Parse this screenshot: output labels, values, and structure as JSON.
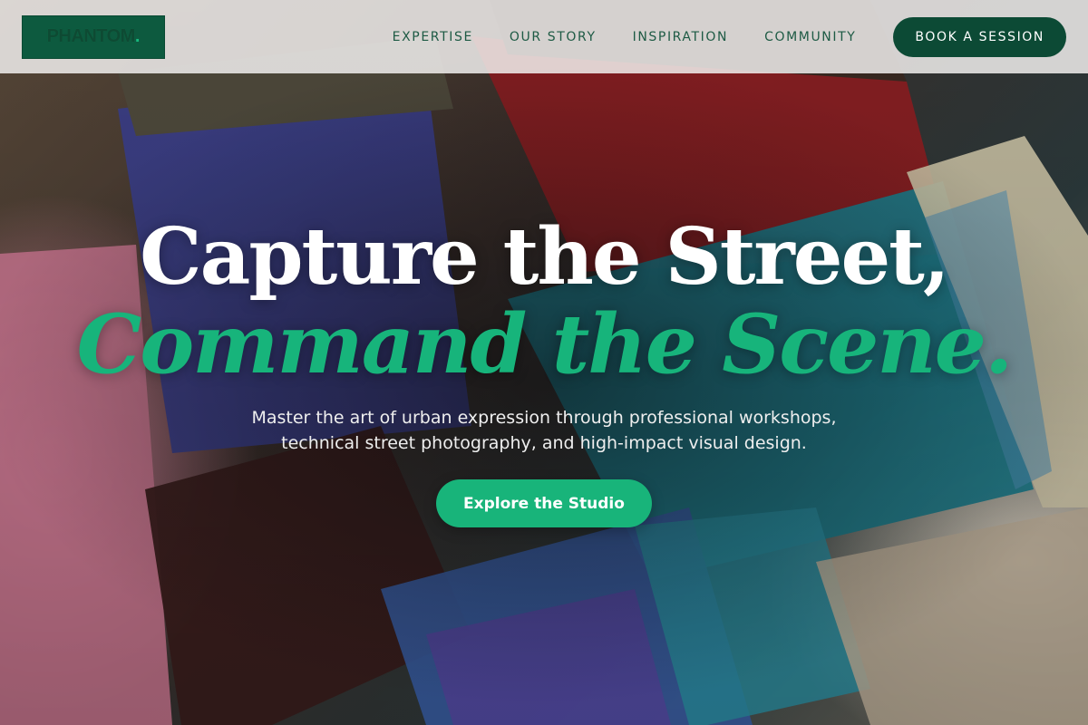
{
  "header": {
    "logo_text": "PHANTOM",
    "logo_dot": ".",
    "nav_items": [
      {
        "label": "EXPERTISE"
      },
      {
        "label": "OUR STORY"
      },
      {
        "label": "INSPIRATION"
      },
      {
        "label": "COMMUNITY"
      }
    ],
    "cta_label": "BOOK A SESSION"
  },
  "hero": {
    "headline_line1": "Capture the Street,",
    "headline_line2": "Command the Scene.",
    "subtitle_line1": "Master the art of urban expression through professional workshops,",
    "subtitle_line2": "technical street photography, and high-impact visual design.",
    "button_label": "Explore the Studio",
    "background_image": "paint-brushes-photo"
  },
  "colors": {
    "brand_dark_green": "#0c4a35",
    "accent_green": "#17b47b",
    "header_bg": "#f0eeec",
    "nav_text": "#1d5a44",
    "hero_text": "#ffffff"
  }
}
